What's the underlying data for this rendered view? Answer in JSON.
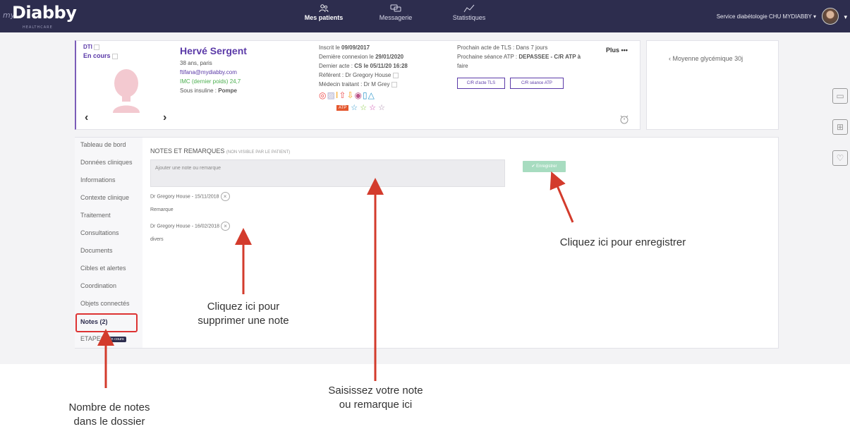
{
  "header": {
    "logo_prefix": "my",
    "logo_brand": "Diabby",
    "logo_sub": "HEALTHCARE",
    "nav": [
      {
        "label": "Mes patients",
        "icon": "patients-icon"
      },
      {
        "label": "Messagerie",
        "icon": "chat-icon"
      },
      {
        "label": "Statistiques",
        "icon": "chart-line-icon"
      }
    ],
    "service": "Service diabétologie CHU MYDIABBY"
  },
  "patient": {
    "dti": "DTI",
    "status": "En cours",
    "name": "Hervé Sergent",
    "age_city": "38 ans, paris",
    "email": "ftifana@mydiabby.com",
    "imc": "IMC (dernier poids) 24,7",
    "insulin_label": "Sous insuline :",
    "insulin_value": "Pompe",
    "inscrit_label": "Inscrit le",
    "inscrit_value": "09/09/2017",
    "derniere_connexion_label": "Dernière connexion le",
    "derniere_connexion_value": "29/01/2020",
    "dernier_acte_label": "Dernier acte :",
    "dernier_acte_value": "CS le 05/11/20 16:28",
    "referent": "Référent : Dr Gregory House",
    "medecin": "Médecin traitant : Dr M Grey",
    "prochain_acte": "Prochain acte de TLS : Dans 7 jours",
    "prochaine_seance_label": "Prochaine séance ATP :",
    "prochaine_seance_value": "DEPASSEE - C/R ATP à",
    "prochaine_seance_cont": "faire",
    "btn_cr_tls": "C/R d'acte TLS",
    "btn_cr_atp": "C/R séance ATP",
    "plus": "Plus •••",
    "atp_badge": "ATP",
    "nav_prev": "‹",
    "nav_next": "›"
  },
  "glycemie": {
    "label": "Moyenne glycémique 30j",
    "arrow": "‹"
  },
  "side_menu": [
    "Tableau de bord",
    "Données cliniques",
    "Informations",
    "Contexte clinique",
    "Traitement",
    "Consultations",
    "Documents",
    "Cibles et alertes",
    "Coordination",
    "Objets connectés",
    "Notes (2)",
    "ETAPES"
  ],
  "etapes_badge": "En cours",
  "notes": {
    "title": "NOTES ET REMARQUES",
    "title_sub": "(NON VISIBLE PAR LE PATIENT)",
    "placeholder": "Ajouter une note ou remarque",
    "save": "✔ Enregistrer",
    "items": [
      {
        "author": "Dr Gregory House - 15/11/2018",
        "text": "Remarque"
      },
      {
        "author": "Dr Gregory House - 16/02/2018",
        "text": "divers"
      }
    ]
  },
  "annotations": {
    "save": "Cliquez ici pour enregistrer",
    "delete_1": "Cliquez ici pour",
    "delete_2": "supprimer une note",
    "input_1": "Saisissez votre note",
    "input_2": "ou remarque ici",
    "count_1": "Nombre de notes",
    "count_2": "dans le dossier"
  },
  "colors": {
    "topbar": "#2d2d4e",
    "accent": "#5b3aa8",
    "arrow": "#d33b2c",
    "save": "#a7dcc0"
  }
}
